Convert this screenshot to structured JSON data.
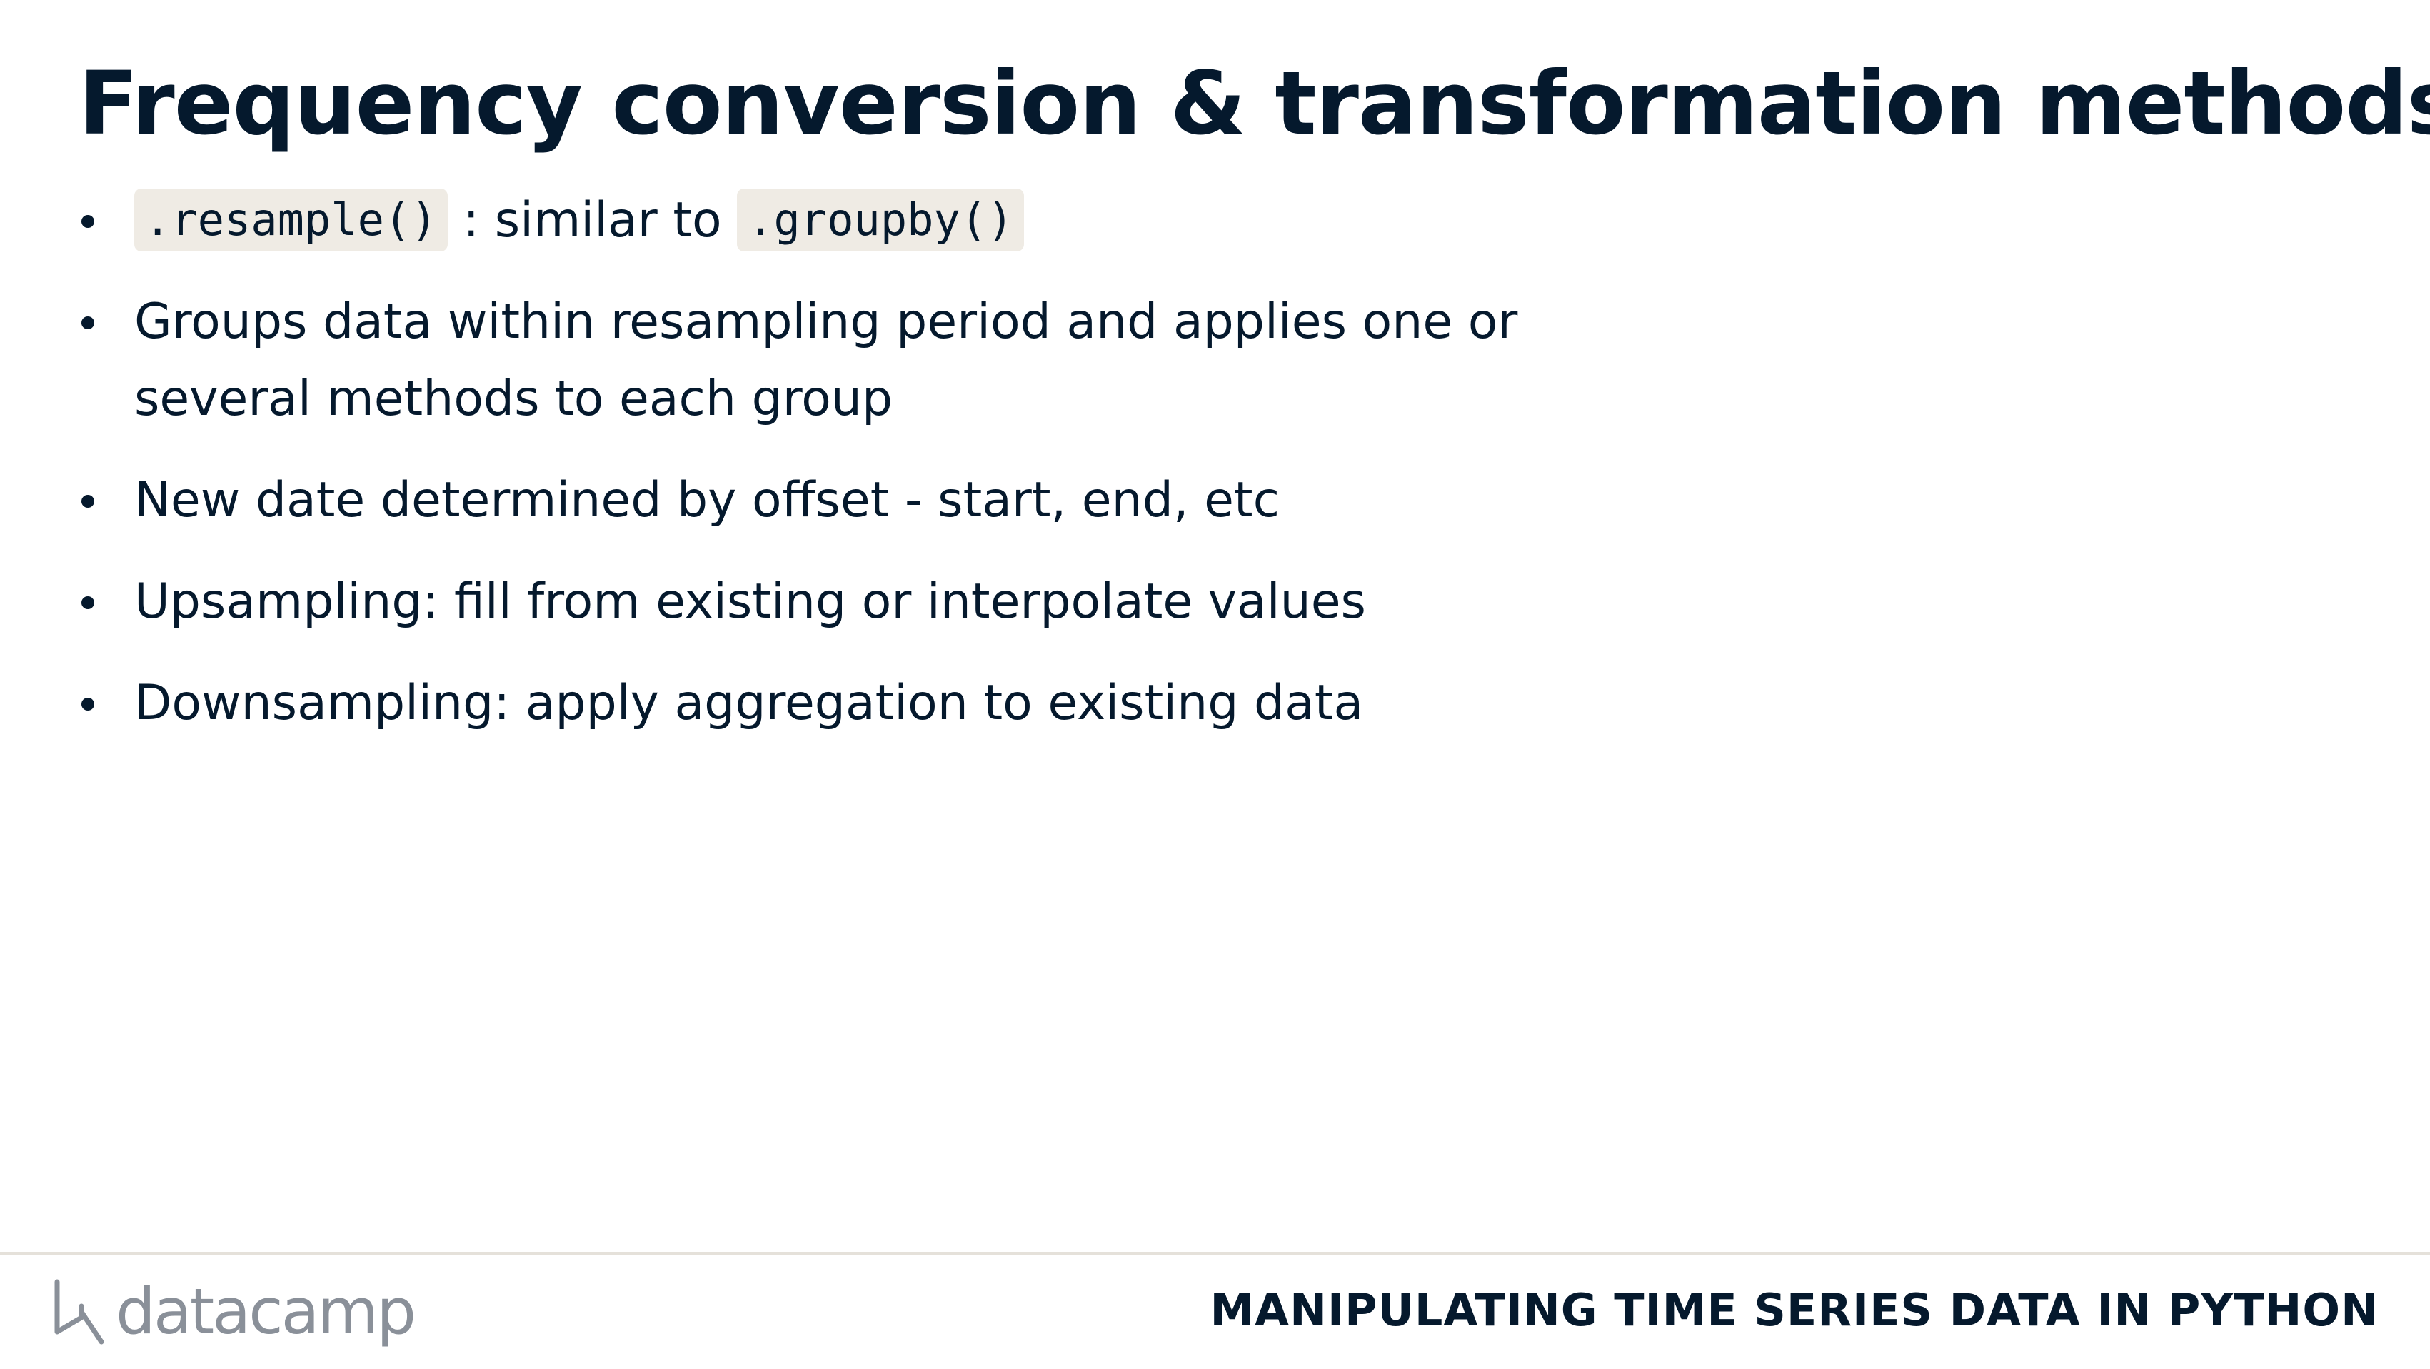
{
  "slide": {
    "title": "Frequency conversion & transformation methods"
  },
  "bullets": [
    {
      "code_1": ".resample()",
      "text_1": " : similar to ",
      "code_2": ".groupby()"
    },
    {
      "text": "Groups data within resampling period and applies one or several methods to each group"
    },
    {
      "text": "New date determined by offset - start, end, etc"
    },
    {
      "text": "Upsampling: fill from existing or interpolate values"
    },
    {
      "text": "Downsampling: apply aggregation to existing data"
    }
  ],
  "footer": {
    "logo_text": "datacamp",
    "logo_icon": "datacamp-logo-icon",
    "course_title": "MANIPULATING TIME SERIES DATA IN PYTHON"
  },
  "colors": {
    "text": "#05192d",
    "code_background": "#efebe4",
    "logo_gray": "#8a9099",
    "divider": "#e5e1da"
  }
}
